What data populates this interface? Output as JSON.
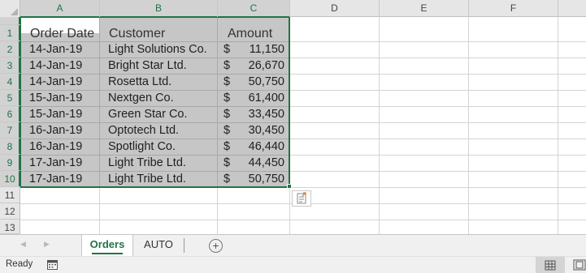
{
  "columns": [
    "A",
    "B",
    "C",
    "D",
    "E",
    "F"
  ],
  "rows": [
    "1",
    "2",
    "3",
    "4",
    "5",
    "6",
    "7",
    "8",
    "9",
    "10",
    "11",
    "12",
    "13"
  ],
  "table": {
    "headers": [
      "Order Date",
      "Customer",
      "Amount"
    ],
    "currency_symbol": "$",
    "records": [
      {
        "date": "14-Jan-19",
        "customer": "Light Solutions Co.",
        "amount": "11,150"
      },
      {
        "date": "14-Jan-19",
        "customer": "Bright Star Ltd.",
        "amount": "26,670"
      },
      {
        "date": "14-Jan-19",
        "customer": "Rosetta Ltd.",
        "amount": "50,750"
      },
      {
        "date": "15-Jan-19",
        "customer": "Nextgen Co.",
        "amount": "61,400"
      },
      {
        "date": "15-Jan-19",
        "customer": "Green Star Co.",
        "amount": "33,450"
      },
      {
        "date": "16-Jan-19",
        "customer": "Optotech Ltd.",
        "amount": "30,450"
      },
      {
        "date": "16-Jan-19",
        "customer": "Spotlight Co.",
        "amount": "46,440"
      },
      {
        "date": "17-Jan-19",
        "customer": "Light Tribe Ltd.",
        "amount": "44,450"
      },
      {
        "date": "17-Jan-19",
        "customer": "Light Tribe Ltd.",
        "amount": "50,750"
      }
    ]
  },
  "selection": {
    "range": "A1:C10",
    "active_cell": "A1"
  },
  "sheet_tabs": [
    {
      "label": "Orders",
      "active": true
    },
    {
      "label": "AUTO",
      "active": false
    }
  ],
  "icons": {
    "nav_prev": "scroll-left-icon",
    "nav_next": "scroll-right-icon",
    "add_sheet": "plus-icon",
    "quick_analysis": "quick-analysis-icon",
    "macro": "macro-recording-icon",
    "normal_view": "normal-view-icon",
    "page_layout": "page-layout-view-icon"
  },
  "status": {
    "ready_text": "Ready"
  },
  "colors": {
    "accent": "#217346",
    "selection_fill": "#c6c6c6",
    "header_bg": "#e6e6e6"
  }
}
